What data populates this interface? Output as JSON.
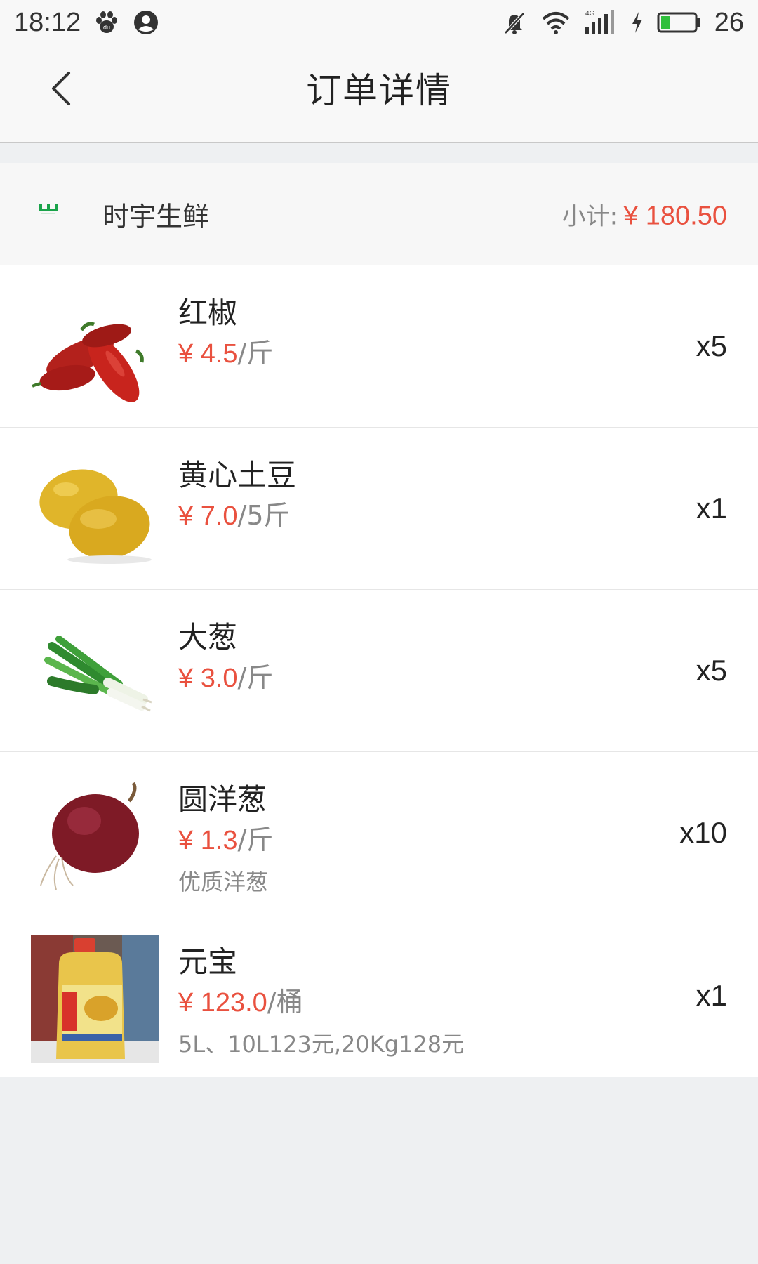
{
  "status_bar": {
    "time": "18:12",
    "battery_pct": "26",
    "network_label": "4G",
    "icons": [
      "baidu-paw-icon",
      "account-icon",
      "mute-icon",
      "wifi-icon",
      "signal-icon",
      "charging-icon",
      "battery-icon"
    ],
    "battery_level": 0.26
  },
  "header": {
    "title": "订单详情",
    "back_icon": "chevron-left-icon"
  },
  "shop": {
    "name": "时宇生鲜",
    "subtotal_label": "小计:",
    "subtotal_value": "¥ 180.50"
  },
  "items": [
    {
      "name": "红椒",
      "price": "¥ 4.5",
      "unit": "/斤",
      "quantity": "x5",
      "description": "",
      "thumb": "red-pepper"
    },
    {
      "name": "黄心土豆",
      "price": "¥ 7.0",
      "unit": "/5斤",
      "quantity": "x1",
      "description": "",
      "thumb": "potato"
    },
    {
      "name": "大葱",
      "price": "¥ 3.0",
      "unit": "/斤",
      "quantity": "x5",
      "description": "",
      "thumb": "green-onion"
    },
    {
      "name": "圆洋葱",
      "price": "¥ 1.3",
      "unit": "/斤",
      "quantity": "x10",
      "description": "优质洋葱",
      "thumb": "red-onion"
    },
    {
      "name": "元宝",
      "price": "¥ 123.0",
      "unit": "/桶",
      "quantity": "x1",
      "description": "5L、10L123元,20Kg128元",
      "thumb": "oil-bottle"
    }
  ],
  "colors": {
    "accent_price": "#e9513f",
    "background": "#eef0f2",
    "header_bg": "#f8f8f8",
    "battery_green": "#2fbf3c",
    "logo_green": "#1aa34a"
  }
}
